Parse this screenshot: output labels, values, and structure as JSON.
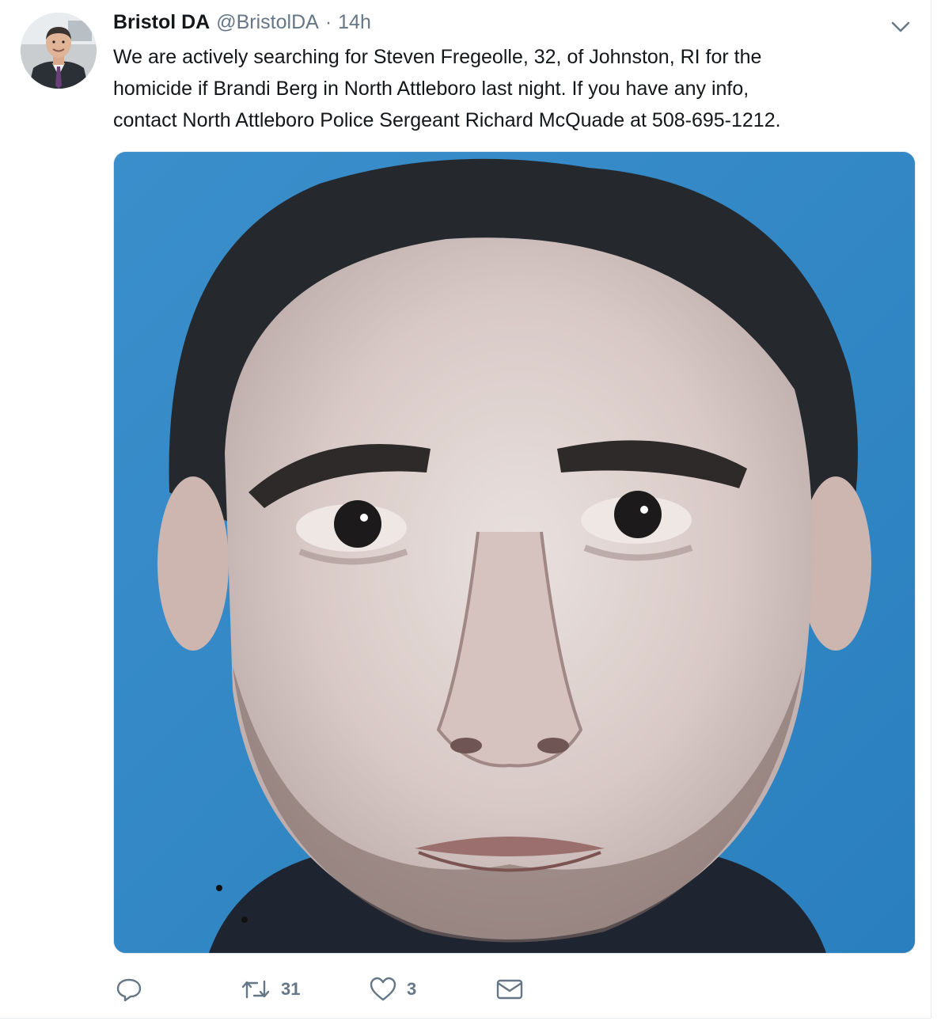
{
  "tweet": {
    "display_name": "Bristol DA",
    "handle": "@BristolDA",
    "separator": "·",
    "time": "14h",
    "text_lines": [
      "We are actively searching for Steven Fregeolle, 32, of Johnston, RI for the",
      "homicide if Brandi Berg in North Attleboro last night.  If you have any info,",
      "contact North Attleboro Police Sergeant Richard McQuade at 508-695-1212."
    ],
    "avatar_icon": "avatar-photo",
    "media_icon": "suspect-photo"
  },
  "actions": {
    "reply_icon": "reply-icon",
    "retweet_icon": "retweet-icon",
    "retweet_count": "31",
    "like_icon": "heart-icon",
    "like_count": "3",
    "dm_icon": "envelope-icon"
  },
  "colors": {
    "text": "#14171a",
    "secondary": "#657786",
    "border": "#e6ecf0",
    "photo_background": "#2f89c4"
  }
}
